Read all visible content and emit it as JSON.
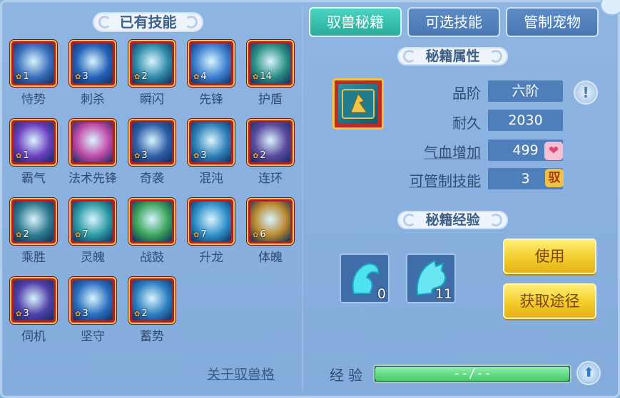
{
  "owned_skills": {
    "title": "已有技能",
    "items": [
      {
        "name": "恃势",
        "level": "1",
        "icon": "skill-shishi-icon",
        "color": "#3a6fbd"
      },
      {
        "name": "刺杀",
        "level": "3",
        "icon": "skill-cisha-icon",
        "color": "#2462b8"
      },
      {
        "name": "瞬闪",
        "level": "2",
        "icon": "skill-shunshan-icon",
        "color": "#2f8aa8"
      },
      {
        "name": "先锋",
        "level": "4",
        "icon": "skill-xianfeng-icon",
        "color": "#3c7fd0"
      },
      {
        "name": "护盾",
        "level": "14",
        "icon": "skill-hudun-icon",
        "color": "#2a8f84"
      },
      {
        "name": "霸气",
        "level": "1",
        "icon": "skill-baqi-icon",
        "color": "#6b3fbf"
      },
      {
        "name": "法术先锋",
        "level": "",
        "icon": "skill-fashuxianfeng-icon",
        "color": "#c04aa8"
      },
      {
        "name": "奇袭",
        "level": "3",
        "icon": "skill-qixi-icon",
        "color": "#2d5fa6"
      },
      {
        "name": "混沌",
        "level": "3",
        "icon": "skill-hundun-icon",
        "color": "#2e7fb8"
      },
      {
        "name": "连环",
        "level": "2",
        "icon": "skill-lianhuan-icon",
        "color": "#5b4a9e"
      },
      {
        "name": "乘胜",
        "level": "2",
        "icon": "skill-chengsheng-icon",
        "color": "#2f7a8e"
      },
      {
        "name": "灵魄",
        "level": "7",
        "icon": "skill-lingpo-icon",
        "color": "#2b9aa3"
      },
      {
        "name": "战鼓",
        "level": "",
        "icon": "skill-zhangu-icon",
        "color": "#3aa35a"
      },
      {
        "name": "升龙",
        "level": "7",
        "icon": "skill-shenglong-icon",
        "color": "#2e8fc8"
      },
      {
        "name": "体魄",
        "level": "6",
        "icon": "skill-tipo-icon",
        "color": "#b8872e"
      },
      {
        "name": "伺机",
        "level": "3",
        "icon": "skill-siji-icon",
        "color": "#5040a8"
      },
      {
        "name": "坚守",
        "level": "3",
        "icon": "skill-jianshou-icon",
        "color": "#2b6fbf"
      },
      {
        "name": "蓄势",
        "level": "2",
        "icon": "skill-xushi-icon",
        "color": "#2c7fc0"
      }
    ],
    "footer_link": "关于驭兽格"
  },
  "tabs": [
    {
      "label": "驭兽秘籍",
      "active": true
    },
    {
      "label": "可选技能",
      "active": false
    },
    {
      "label": "管制宠物",
      "active": false
    }
  ],
  "book_attrs": {
    "title": "秘籍属性",
    "book_icon": "secret-book-icon",
    "grade_label": "品阶",
    "grade_value": "六阶",
    "durability_label": "耐久",
    "durability_value": "2030",
    "hp_label": "气血增加",
    "hp_value": "499",
    "skills_label": "可管制技能",
    "skills_value": "3",
    "yu_glyph": "驭"
  },
  "book_exp": {
    "title": "秘籍经验",
    "items": [
      {
        "icon": "cyan-beast-head-icon",
        "count": "0"
      },
      {
        "icon": "cyan-dragon-head-icon",
        "count": "11"
      }
    ],
    "use_button": "使用",
    "obtain_button": "获取途径",
    "exp_label": "经验",
    "progress_text": "--/--",
    "progress_fraction": 1.0
  },
  "colors": {
    "active_tab": "#33b8a8",
    "inactive_tab": "#4f7fbb",
    "panel_bg": "#8ab0df",
    "gold_button": "#f2cc2a",
    "skill_frame": "#b11e23"
  }
}
